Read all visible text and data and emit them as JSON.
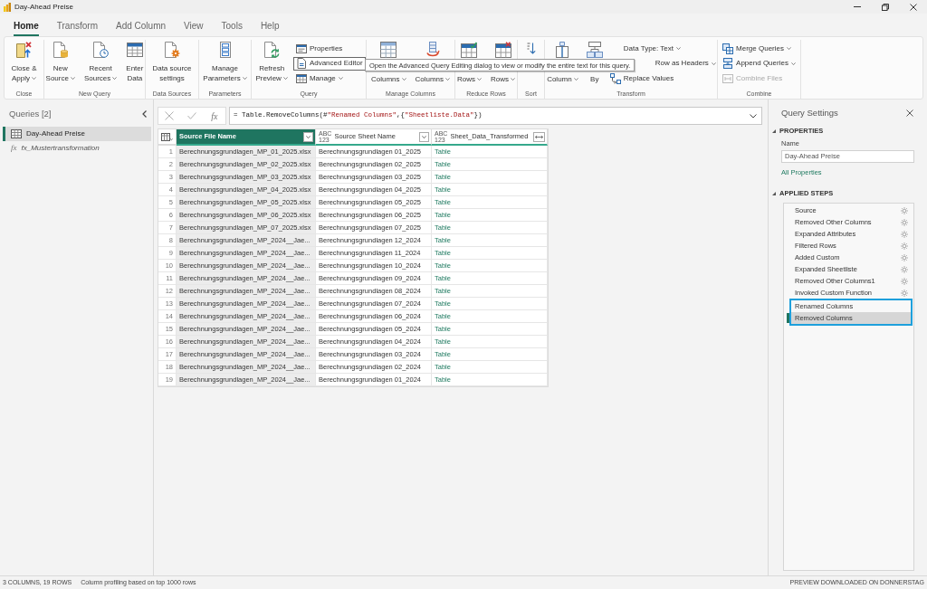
{
  "window": {
    "title": "Day-Ahead Preise"
  },
  "tabs": [
    {
      "label": "Home",
      "selected": true
    },
    {
      "label": "Transform",
      "selected": false
    },
    {
      "label": "Add Column",
      "selected": false
    },
    {
      "label": "View",
      "selected": false
    },
    {
      "label": "Tools",
      "selected": false
    },
    {
      "label": "Help",
      "selected": false
    }
  ],
  "ribbon": {
    "groups": [
      {
        "label": "Close",
        "buttons": [
          {
            "kind": "large",
            "lines": [
              "Close &",
              "Apply"
            ],
            "dropdown": true
          }
        ]
      },
      {
        "label": "New Query",
        "buttons": [
          {
            "kind": "large",
            "lines": [
              "New",
              "Source"
            ],
            "dropdown": true
          },
          {
            "kind": "large",
            "lines": [
              "Recent",
              "Sources"
            ],
            "dropdown": true
          },
          {
            "kind": "large",
            "lines": [
              "Enter",
              "Data"
            ],
            "dropdown": false
          }
        ]
      },
      {
        "label": "Data Sources",
        "buttons": [
          {
            "kind": "large",
            "lines": [
              "Data source",
              "settings"
            ],
            "dropdown": false
          }
        ]
      },
      {
        "label": "Parameters",
        "buttons": [
          {
            "kind": "large",
            "lines": [
              "Manage",
              "Parameters"
            ],
            "dropdown": true
          }
        ]
      },
      {
        "label": "Query",
        "buttons": [
          {
            "kind": "large",
            "lines": [
              "Refresh",
              "Preview"
            ],
            "dropdown": true,
            "hovered": false
          },
          {
            "kind": "small",
            "lines": [
              "Properties"
            ],
            "dropdown": false,
            "hovered": false
          },
          {
            "kind": "small",
            "lines": [
              "Advanced Editor"
            ],
            "dropdown": false,
            "hovered": true
          },
          {
            "kind": "small",
            "lines": [
              "Manage"
            ],
            "dropdown": true,
            "hovered": false
          }
        ]
      },
      {
        "label": "Manage Columns",
        "buttons": [
          {
            "kind": "large",
            "lines": [
              "Columns"
            ],
            "dropdown": true
          },
          {
            "kind": "large",
            "lines": [
              "Columns"
            ],
            "dropdown": true
          }
        ]
      },
      {
        "label": "Reduce Rows",
        "buttons": [
          {
            "kind": "large",
            "lines": [
              "Rows"
            ],
            "dropdown": true
          },
          {
            "kind": "large",
            "lines": [
              "Rows"
            ],
            "dropdown": true
          }
        ]
      },
      {
        "label": "Sort",
        "buttons": [
          {
            "kind": "icon"
          }
        ]
      },
      {
        "label": "Transform",
        "buttons": [
          {
            "kind": "large",
            "lines": [
              "Column"
            ],
            "dropdown": true
          },
          {
            "kind": "large",
            "lines": [
              "By"
            ],
            "dropdown": false
          },
          {
            "kind": "small",
            "lines": [
              "Data Type: Text"
            ],
            "dropdown": true
          },
          {
            "kind": "clipped",
            "lines": [
              "Row as Headers"
            ],
            "dropdown": true
          },
          {
            "kind": "small",
            "lines": [
              "Replace Values"
            ],
            "dropdown": false
          }
        ]
      },
      {
        "label": "Combine",
        "buttons": [
          {
            "kind": "small",
            "lines": [
              "Merge Queries"
            ],
            "dropdown": true,
            "disabled": false
          },
          {
            "kind": "small",
            "lines": [
              "Append Queries"
            ],
            "dropdown": true,
            "disabled": false
          },
          {
            "kind": "small",
            "lines": [
              "Combine Files"
            ],
            "dropdown": false,
            "disabled": true
          }
        ]
      }
    ]
  },
  "tooltip": "Open the Advanced Query Editing dialog to view or modify the entire text for this query.",
  "queries": {
    "title": "Queries [2]",
    "items": [
      {
        "kind": "table",
        "label": "Day-Ahead Preise",
        "selected": true
      },
      {
        "kind": "function",
        "prefix": "fx",
        "label": "fx_Mustertransformation",
        "selected": false
      }
    ]
  },
  "formula_bar": {
    "function_button": "fx",
    "formula": "= Table.RemoveColumns(#\"Renamed Columns\",{\"Sheetliste.Data\"})"
  },
  "table": {
    "columns": [
      {
        "name": "Source File Name",
        "kind": "text",
        "selected": true
      },
      {
        "name": "Source Sheet Name",
        "type_label": [
          "ABC",
          "123"
        ],
        "kind": "text",
        "selected": false
      },
      {
        "name": "Sheet_Data_Transformed",
        "type_label": [
          "ABC",
          "123"
        ],
        "kind": "table",
        "selected": false
      }
    ],
    "rows": [
      {
        "number": "1",
        "cells": [
          "Berechnungsgrundlagen_MP_01_2025.xlsx",
          "Berechnungsgrundlagen 01_2025",
          "Table"
        ]
      },
      {
        "number": "2",
        "cells": [
          "Berechnungsgrundlagen_MP_02_2025.xlsx",
          "Berechnungsgrundlagen 02_2025",
          "Table"
        ]
      },
      {
        "number": "3",
        "cells": [
          "Berechnungsgrundlagen_MP_03_2025.xlsx",
          "Berechnungsgrundlagen 03_2025",
          "Table"
        ]
      },
      {
        "number": "4",
        "cells": [
          "Berechnungsgrundlagen_MP_04_2025.xlsx",
          "Berechnungsgrundlagen 04_2025",
          "Table"
        ]
      },
      {
        "number": "5",
        "cells": [
          "Berechnungsgrundlagen_MP_05_2025.xlsx",
          "Berechnungsgrundlagen 05_2025",
          "Table"
        ]
      },
      {
        "number": "6",
        "cells": [
          "Berechnungsgrundlagen_MP_06_2025.xlsx",
          "Berechnungsgrundlagen 06_2025",
          "Table"
        ]
      },
      {
        "number": "7",
        "cells": [
          "Berechnungsgrundlagen_MP_07_2025.xlsx",
          "Berechnungsgrundlagen 07_2025",
          "Table"
        ]
      },
      {
        "number": "8",
        "cells": [
          "Berechnungsgrundlagen_MP_2024__Jae...",
          "Berechnungsgrundlagen 12_2024",
          "Table"
        ]
      },
      {
        "number": "9",
        "cells": [
          "Berechnungsgrundlagen_MP_2024__Jae...",
          "Berechnungsgrundlagen 11_2024",
          "Table"
        ]
      },
      {
        "number": "10",
        "cells": [
          "Berechnungsgrundlagen_MP_2024__Jae...",
          "Berechnungsgrundlagen 10_2024",
          "Table"
        ]
      },
      {
        "number": "11",
        "cells": [
          "Berechnungsgrundlagen_MP_2024__Jae...",
          "Berechnungsgrundlagen 09_2024",
          "Table"
        ]
      },
      {
        "number": "12",
        "cells": [
          "Berechnungsgrundlagen_MP_2024__Jae...",
          "Berechnungsgrundlagen 08_2024",
          "Table"
        ]
      },
      {
        "number": "13",
        "cells": [
          "Berechnungsgrundlagen_MP_2024__Jae...",
          "Berechnungsgrundlagen 07_2024",
          "Table"
        ]
      },
      {
        "number": "14",
        "cells": [
          "Berechnungsgrundlagen_MP_2024__Jae...",
          "Berechnungsgrundlagen 06_2024",
          "Table"
        ]
      },
      {
        "number": "15",
        "cells": [
          "Berechnungsgrundlagen_MP_2024__Jae...",
          "Berechnungsgrundlagen 05_2024",
          "Table"
        ]
      },
      {
        "number": "16",
        "cells": [
          "Berechnungsgrundlagen_MP_2024__Jae...",
          "Berechnungsgrundlagen 04_2024",
          "Table"
        ]
      },
      {
        "number": "17",
        "cells": [
          "Berechnungsgrundlagen_MP_2024__Jae...",
          "Berechnungsgrundlagen 03_2024",
          "Table"
        ]
      },
      {
        "number": "18",
        "cells": [
          "Berechnungsgrundlagen_MP_2024__Jae...",
          "Berechnungsgrundlagen 02_2024",
          "Table"
        ]
      },
      {
        "number": "19",
        "cells": [
          "Berechnungsgrundlagen_MP_2024__Jae...",
          "Berechnungsgrundlagen 01_2024",
          "Table"
        ]
      }
    ]
  },
  "query_settings": {
    "title": "Query Settings",
    "properties": {
      "heading": "PROPERTIES",
      "expanded": true,
      "name_label": "Name",
      "name_value": "Day-Ahead Preise",
      "link": "All Properties"
    },
    "applied_steps": {
      "heading": "APPLIED STEPS",
      "expanded": true,
      "steps": [
        {
          "label": "Source",
          "settings_icon": true,
          "selected": false,
          "highlighted": false
        },
        {
          "label": "Removed Other Columns",
          "settings_icon": true,
          "selected": false,
          "highlighted": false
        },
        {
          "label": "Expanded Attributes",
          "settings_icon": true,
          "selected": false,
          "highlighted": false
        },
        {
          "label": "Filtered Rows",
          "settings_icon": true,
          "selected": false,
          "highlighted": false
        },
        {
          "label": "Added Custom",
          "settings_icon": true,
          "selected": false,
          "highlighted": false
        },
        {
          "label": "Expanded Sheetliste",
          "settings_icon": true,
          "selected": false,
          "highlighted": false
        },
        {
          "label": "Removed Other Columns1",
          "settings_icon": true,
          "selected": false,
          "highlighted": false
        },
        {
          "label": "Invoked Custom Function",
          "settings_icon": true,
          "selected": false,
          "highlighted": false
        },
        {
          "label": "Renamed Columns",
          "settings_icon": false,
          "selected": false,
          "highlighted": true
        },
        {
          "label": "Removed Columns",
          "settings_icon": false,
          "selected": true,
          "highlighted": true
        }
      ]
    }
  },
  "status_bar": {
    "left": [
      "3 COLUMNS, 19 ROWS",
      "Column profiling based on top 1000 rows"
    ],
    "right": "PREVIEW DOWNLOADED ON DONNERSTAG"
  }
}
